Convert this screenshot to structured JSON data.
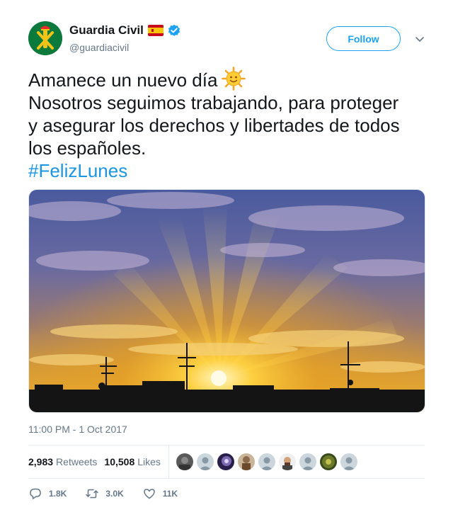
{
  "author": {
    "display_name": "Guardia Civil",
    "handle": "@guardiacivil",
    "avatar_icon": "guardia-civil-emblem-icon",
    "flag_icon": "spain-flag-icon",
    "verified_icon": "verified-badge-icon"
  },
  "follow_label": "Follow",
  "tweet": {
    "line1": "Amanece un nuevo día",
    "line2": "Nosotros seguimos trabajando, para proteger",
    "line3": "y asegurar los derechos y libertades de todos",
    "line4": "los españoles.",
    "hashtag": "#FelizLunes",
    "emoji_icon": "sun-with-face-icon"
  },
  "media": {
    "description_icon": "sunrise-photo"
  },
  "timestamp": "11:00 PM - 1 Oct 2017",
  "stats": {
    "retweets_count": "2,983",
    "retweets_label": "Retweets",
    "likes_count": "10,508",
    "likes_label": "Likes"
  },
  "actions": {
    "reply_count": "1.8K",
    "retweet_count": "3.0K",
    "like_count": "11K"
  },
  "colors": {
    "brand_blue": "#1da1f2",
    "hashtag_blue": "#1b95e0",
    "muted_text": "#657786",
    "avatar_green": "#0d7a3a"
  }
}
